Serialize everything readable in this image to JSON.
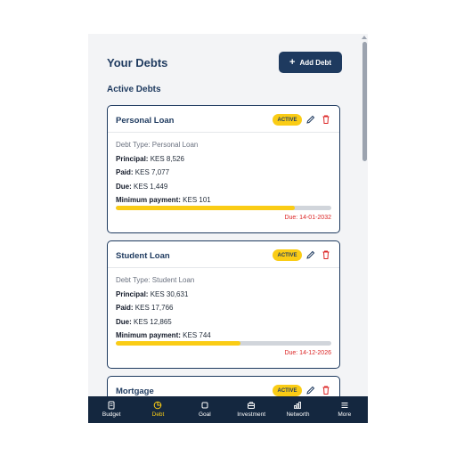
{
  "header": {
    "title": "Your Debts",
    "add_button": "Add Debt"
  },
  "section": {
    "title": "Active Debts"
  },
  "debts": [
    {
      "name": "Personal Loan",
      "status": "ACTIVE",
      "type": "Debt Type: Personal Loan",
      "principal_label": "Principal:",
      "principal": "KES 8,526",
      "paid_label": "Paid:",
      "paid": "KES 7,077",
      "due_label": "Due:",
      "due": "KES 1,449",
      "min_label": "Minimum payment:",
      "min": "KES 101",
      "progress": 0.83,
      "due_date": "Due: 14-01-2032"
    },
    {
      "name": "Student Loan",
      "status": "ACTIVE",
      "type": "Debt Type: Student Loan",
      "principal_label": "Principal:",
      "principal": "KES 30,631",
      "paid_label": "Paid:",
      "paid": "KES 17,766",
      "due_label": "Due:",
      "due": "KES 12,865",
      "min_label": "Minimum payment:",
      "min": "KES 744",
      "progress": 0.58,
      "due_date": "Due: 14-12-2026"
    },
    {
      "name": "Mortgage",
      "status": "ACTIVE"
    }
  ],
  "nav": [
    {
      "label": "Budget",
      "icon": "budget-icon"
    },
    {
      "label": "Debt",
      "icon": "debt-icon",
      "active": true
    },
    {
      "label": "Goal",
      "icon": "goal-icon"
    },
    {
      "label": "Investment",
      "icon": "investment-icon"
    },
    {
      "label": "Networth",
      "icon": "networth-icon"
    },
    {
      "label": "More",
      "icon": "menu-icon"
    }
  ],
  "colors": {
    "primary": "#1e3a5f",
    "accent": "#facc15",
    "danger": "#dc2626",
    "nav_bg": "#14273f"
  }
}
